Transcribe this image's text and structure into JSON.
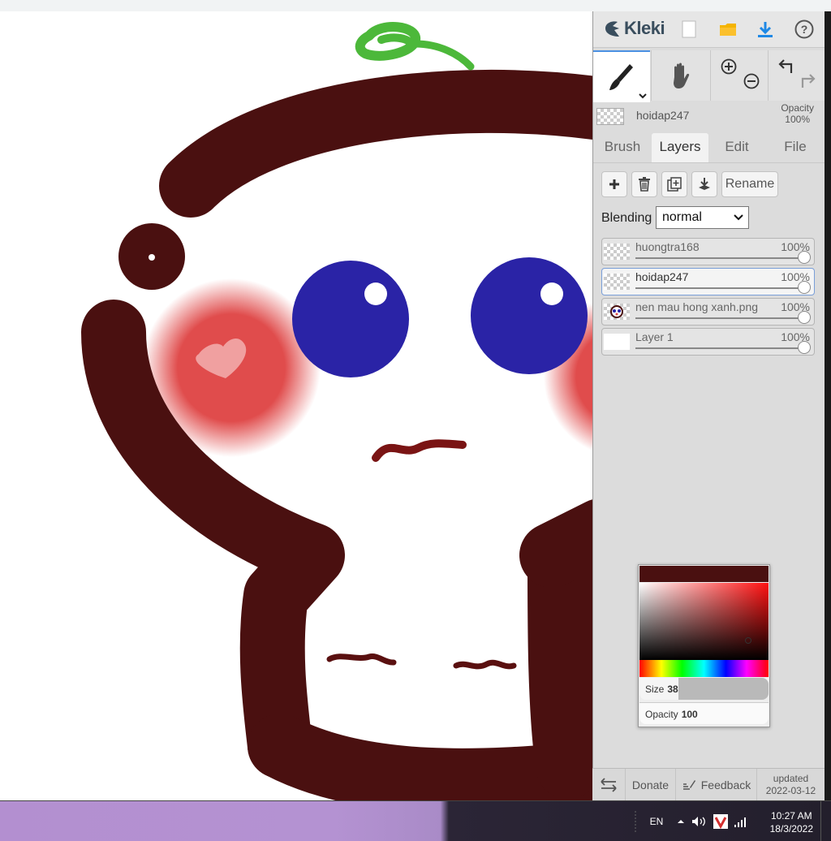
{
  "app": {
    "logo_text": "Kleki"
  },
  "layer_info": {
    "name": "hoidap247",
    "opacity_label": "Opacity",
    "opacity_value": "100%"
  },
  "tabs": [
    {
      "label": "Brush",
      "active": false
    },
    {
      "label": "Layers",
      "active": true
    },
    {
      "label": "Edit",
      "active": false
    },
    {
      "label": "File",
      "active": false
    }
  ],
  "layer_buttons": {
    "rename_label": "Rename"
  },
  "blending": {
    "label": "Blending",
    "value": "normal"
  },
  "layers": [
    {
      "name": "huongtra168",
      "opacity": "100%",
      "active": false
    },
    {
      "name": "hoidap247",
      "opacity": "100%",
      "active": true
    },
    {
      "name": "nen mau hong xanh.png",
      "opacity": "100%",
      "active": false
    },
    {
      "name": "Layer 1",
      "opacity": "100%",
      "active": false
    }
  ],
  "color_picker": {
    "current_color": "#4a1010",
    "size_label": "Size",
    "size_value": "38",
    "opacity_label": "Opacity",
    "opacity_value": "100"
  },
  "footer": {
    "donate_label": "Donate",
    "feedback_label": "Feedback",
    "updated_label": "updated",
    "updated_date": "2022-03-12"
  },
  "taskbar": {
    "language": "EN",
    "time": "10:27 AM",
    "date": "18/3/2022"
  },
  "colors": {
    "brush_brown": "#4a1010",
    "eye_blue": "#2a23a6",
    "cheek_red": "#e04c4c",
    "leaf_green": "#4cb83a",
    "accent_blue": "#1e88e5",
    "folder_yellow": "#f4b400"
  }
}
